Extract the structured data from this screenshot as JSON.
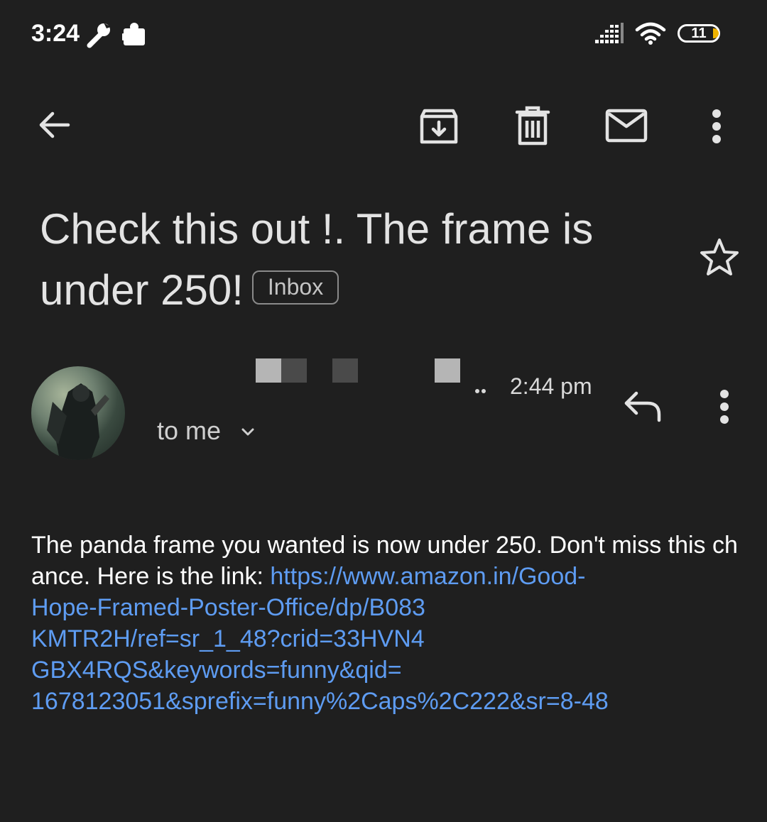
{
  "status_bar": {
    "time": "3:24",
    "battery_level": "11",
    "icons": [
      "wrench-icon",
      "puzzle-icon",
      "signal-icon",
      "wifi-icon",
      "battery-icon"
    ]
  },
  "toolbar": {
    "icons": [
      "back-arrow-icon",
      "archive-icon",
      "delete-icon",
      "mark-unread-icon",
      "more-vert-icon"
    ]
  },
  "email": {
    "subject": "Check this out !. The frame is under 250!",
    "label": "Inbox",
    "time": "2:44 pm",
    "recipient": "to me",
    "body_text": "The panda frame you wanted is now under 250. Don't miss this chance. Here is the link: ",
    "link": "https://www.amazon.in/Good-Hope-Framed-Poster-Office/dp/B083KMTR2H/ref=sr_1_48?crid=33HVN4GBX4RQS&keywords=funny&qid=1678123051&sprefix=funny%2Caps%2C222&sr=8-48",
    "link_lines": [
      "https://www.amazon.in/Good-",
      "Hope-Framed-Poster-Office/dp/B083",
      "KMTR2H/ref=sr_1_48?crid=33HVN4",
      "GBX4RQS&keywords=funny&qid=",
      "1678123051&sprefix=funny%2Caps%2C222&sr=8-48"
    ]
  },
  "colors": {
    "background": "#1f1f1f",
    "link": "#5e9cf2",
    "text": "#e3e3e3"
  }
}
